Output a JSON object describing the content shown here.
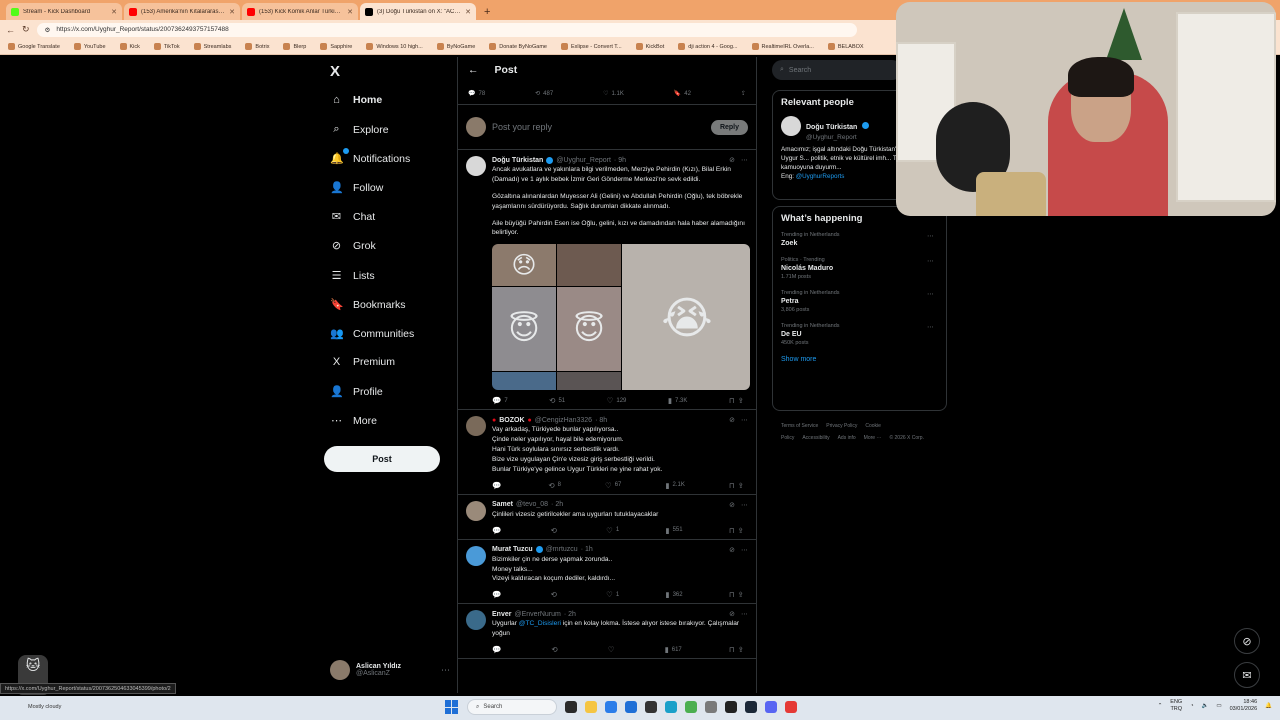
{
  "browser": {
    "tabs": [
      {
        "title": "Stream - Kick Dashboard",
        "color": "#53fc18",
        "active": false
      },
      {
        "title": "(153) Amerika'nın Kıtalararası Yatır...",
        "color": "#ff0000",
        "active": false
      },
      {
        "title": "(153) Kick Komik Anlar Türkiye Re...",
        "color": "#ff0000",
        "active": false
      },
      {
        "title": "(3) Doğu Türkistan on X: \"ACİLİİİ...",
        "color": "#000000",
        "active": true
      }
    ],
    "new_tab": "+",
    "url": "https://x.com/Uyghur_Report/status/2007362493757157488",
    "bookmarks": [
      "Google Translate",
      "YouTube",
      "Kick",
      "TikTok",
      "Streamlabs",
      "Botrix",
      "Blerp",
      "Sapphire",
      "Windows 10 high...",
      "ByNoGame",
      "Donate ByNoGame",
      "Exlipse - Convert T...",
      "KickBot",
      "dji action 4 - Goog...",
      "RealtimeIRL Overla...",
      "BELABOX"
    ]
  },
  "nav": {
    "logo": "X",
    "items": [
      {
        "label": "Home",
        "icon": "home-icon",
        "glyph": "⌂"
      },
      {
        "label": "Explore",
        "icon": "search-icon",
        "glyph": "⌕"
      },
      {
        "label": "Notifications",
        "icon": "bell-icon",
        "glyph": "🔔"
      },
      {
        "label": "Follow",
        "icon": "follow-icon",
        "glyph": "👤"
      },
      {
        "label": "Chat",
        "icon": "mail-icon",
        "glyph": "✉"
      },
      {
        "label": "Grok",
        "icon": "grok-icon",
        "glyph": "⊘"
      },
      {
        "label": "Lists",
        "icon": "lists-icon",
        "glyph": "☰"
      },
      {
        "label": "Bookmarks",
        "icon": "bookmark-icon",
        "glyph": "🔖"
      },
      {
        "label": "Communities",
        "icon": "communities-icon",
        "glyph": "👥"
      },
      {
        "label": "Premium",
        "icon": "x-premium-icon",
        "glyph": "X"
      },
      {
        "label": "Profile",
        "icon": "profile-icon",
        "glyph": "👤"
      },
      {
        "label": "More",
        "icon": "more-icon",
        "glyph": "⋯"
      }
    ],
    "post_button": "Post",
    "account": {
      "name": "Aslican Yıldız",
      "handle": "@AslicanZ"
    }
  },
  "main": {
    "title": "Post",
    "stats": {
      "replies": "78",
      "reposts": "487",
      "likes": "1.1K",
      "bookmarks": "42"
    },
    "reply_placeholder": "Post your reply",
    "reply_button": "Reply",
    "tweets": [
      {
        "name": "Doğu Türkistan",
        "verified": true,
        "handle": "@Uyghur_Report",
        "time": "· 9h",
        "paragraphs": [
          "Ancak avukatlara ve yakınlara bilgi verilmeden, Merziye Pehirdin (Kızı), Bilal Erkin (Damadı) ve 1 aylık bebek İzmir Geri Gönderme Merkezi'ne sevk edildi.",
          "Gözaltına alınanlardan Muyesser Ali (Gelini) ve Abdullah Pehirdin (Oğlu), tek böbrekle yaşamlarını sürdürüyordu. Sağlık durumları dikkate alınmadı.",
          "Aile büyüğü Pahirdin Esen ise Oğlu, gelini, kızı ve damadından hala haber alamadığını belirtiyor."
        ],
        "has_media": true,
        "media_emojis": [
          "😞",
          "😇",
          "😇",
          "😭"
        ],
        "actions": {
          "replies": "7",
          "reposts": "51",
          "likes": "129",
          "views": "7.3K"
        }
      },
      {
        "name": "BOZOK",
        "verified": false,
        "handle": "@CengizHan3326",
        "time": "· 8h",
        "lines": [
          "Vay arkadaş, Türkiyede bunlar yapılıyorsa..",
          "Çinde neler yapılıyor, hayal bile edemiyorum.",
          "Hani Türk soylulara sınırsız serbestlik vardı.",
          "Bize vize uygulayan Çin'e vizesiz giriş serbestliği verildi.",
          "Bunlar Türkiye'ye gelince Uygur Türkleri ne yine rahat yok."
        ],
        "actions": {
          "replies": "",
          "reposts": "8",
          "likes": "67",
          "views": "2.1K"
        }
      },
      {
        "name": "Samet",
        "verified": false,
        "handle": "@tevo_08",
        "time": "· 2h",
        "lines": [
          "Çinlileri vizesiz getirilcekler ama uygurları tutuklayacaklar"
        ],
        "actions": {
          "replies": "",
          "reposts": "",
          "likes": "1",
          "views": "551"
        }
      },
      {
        "name": "Murat Tuzcu",
        "verified": true,
        "handle": "@mrtuzcu",
        "time": "· 1h",
        "lines": [
          "Bizimkiler çin ne derse yapmak zorunda..",
          "Money talks...",
          "Vizeyi kaldıracan koçum dediler, kaldırdı..."
        ],
        "actions": {
          "replies": "",
          "reposts": "",
          "likes": "1",
          "views": "362"
        }
      },
      {
        "name": "Enver",
        "verified": false,
        "handle": "@EnverNurum",
        "time": "· 2h",
        "pre": "Uygurlar ",
        "mention": "@TC_Disisleri",
        "post": " için en kolay lokma. İstese alıyor istese bırakıyor. Çalışmalar yoğun",
        "actions": {
          "replies": "",
          "reposts": "",
          "likes": "",
          "views": "617"
        }
      }
    ]
  },
  "right": {
    "search_placeholder": "Search",
    "relevant_title": "Relevant people",
    "person": {
      "name": "Doğu Türkistan",
      "handle": "@Uyghur_Report",
      "bio": "Amacımız; işgal altındaki Doğu Türkistan'da Çin'in Uygur S... politik, etnik ve kültürel imh... Türkiye kamuoyuna duyurm...",
      "eng_prefix": "Eng: ",
      "eng_handle": "@UyghurReports"
    },
    "happening_title": "What’s happening",
    "trends": [
      {
        "context": "Trending in Netherlands",
        "topic": "Zoek",
        "count": ""
      },
      {
        "context": "Politics · Trending",
        "topic": "Nicolás Maduro",
        "count": "1.71M posts"
      },
      {
        "context": "Trending in Netherlands",
        "topic": "Petra",
        "count": "3,806 posts"
      },
      {
        "context": "Trending in Netherlands",
        "topic": "De EU",
        "count": "450K posts"
      }
    ],
    "show_more": "Show more",
    "footer_links": [
      "Terms of Service",
      "Privacy Policy",
      "Cookie Policy",
      "Accessibility",
      "Ads info",
      "More ···",
      "© 2026 X Corp."
    ]
  },
  "status_url": "https://x.com/Uyghur_Report/status/2007362504633045399/photo/2",
  "taskbar": {
    "weather": "Mostly cloudy",
    "search": "Search",
    "lang_top": "ENG",
    "lang_bottom": "TRQ",
    "time": "18:46",
    "date": "03/01/2026"
  }
}
